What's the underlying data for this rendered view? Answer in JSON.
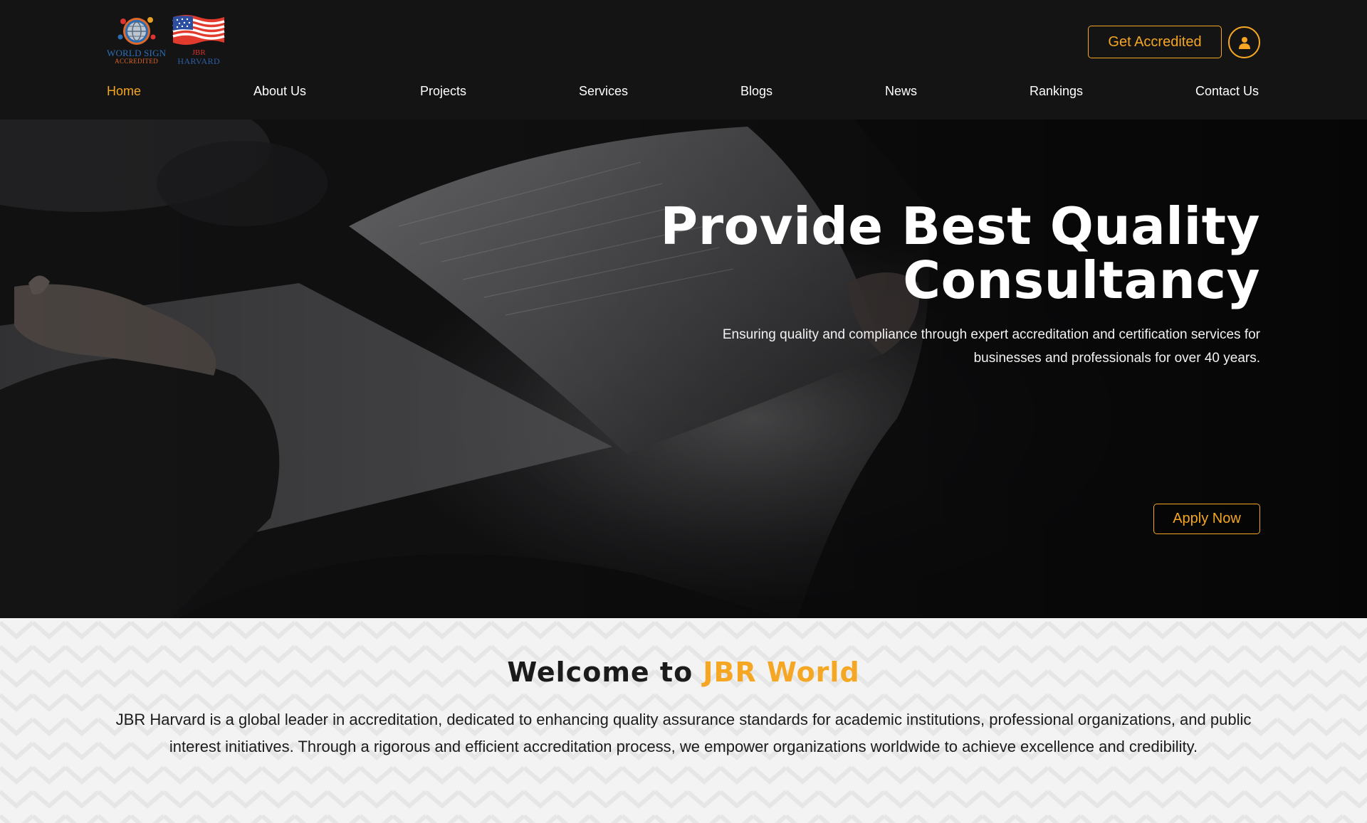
{
  "brand": {
    "logo1": {
      "line1": "WORLD SIGN",
      "line2": "ACCREDITED"
    },
    "logo2": {
      "line1": "JBR",
      "line2": "HARVARD"
    }
  },
  "header": {
    "cta_label": "Get Accredited",
    "user_icon": "user-icon"
  },
  "nav": {
    "items": [
      {
        "label": "Home",
        "active": true
      },
      {
        "label": "About Us"
      },
      {
        "label": "Projects"
      },
      {
        "label": "Services"
      },
      {
        "label": "Blogs"
      },
      {
        "label": "News"
      },
      {
        "label": "Rankings"
      },
      {
        "label": "Contact Us"
      }
    ]
  },
  "hero": {
    "title_line1": "Provide Best Quality",
    "title_line2": "Consultancy",
    "subtitle_line1": "Ensuring quality and compliance through expert accreditation and certification services for",
    "subtitle_line2": "businesses and professionals for over 40 years.",
    "cta_label": "Apply Now"
  },
  "welcome": {
    "title_prefix": "Welcome to",
    "title_accent": "JBR World",
    "body": "JBR Harvard is a global leader in accreditation, dedicated to enhancing quality assurance standards for academic institutions, professional organizations, and public interest initiatives. Through a rigorous and efficient accreditation process, we empower organizations worldwide to achieve excellence and credibility."
  },
  "colors": {
    "accent": "#f5a623",
    "header_bg": "#141414",
    "section_bg": "#f3f3f3"
  }
}
